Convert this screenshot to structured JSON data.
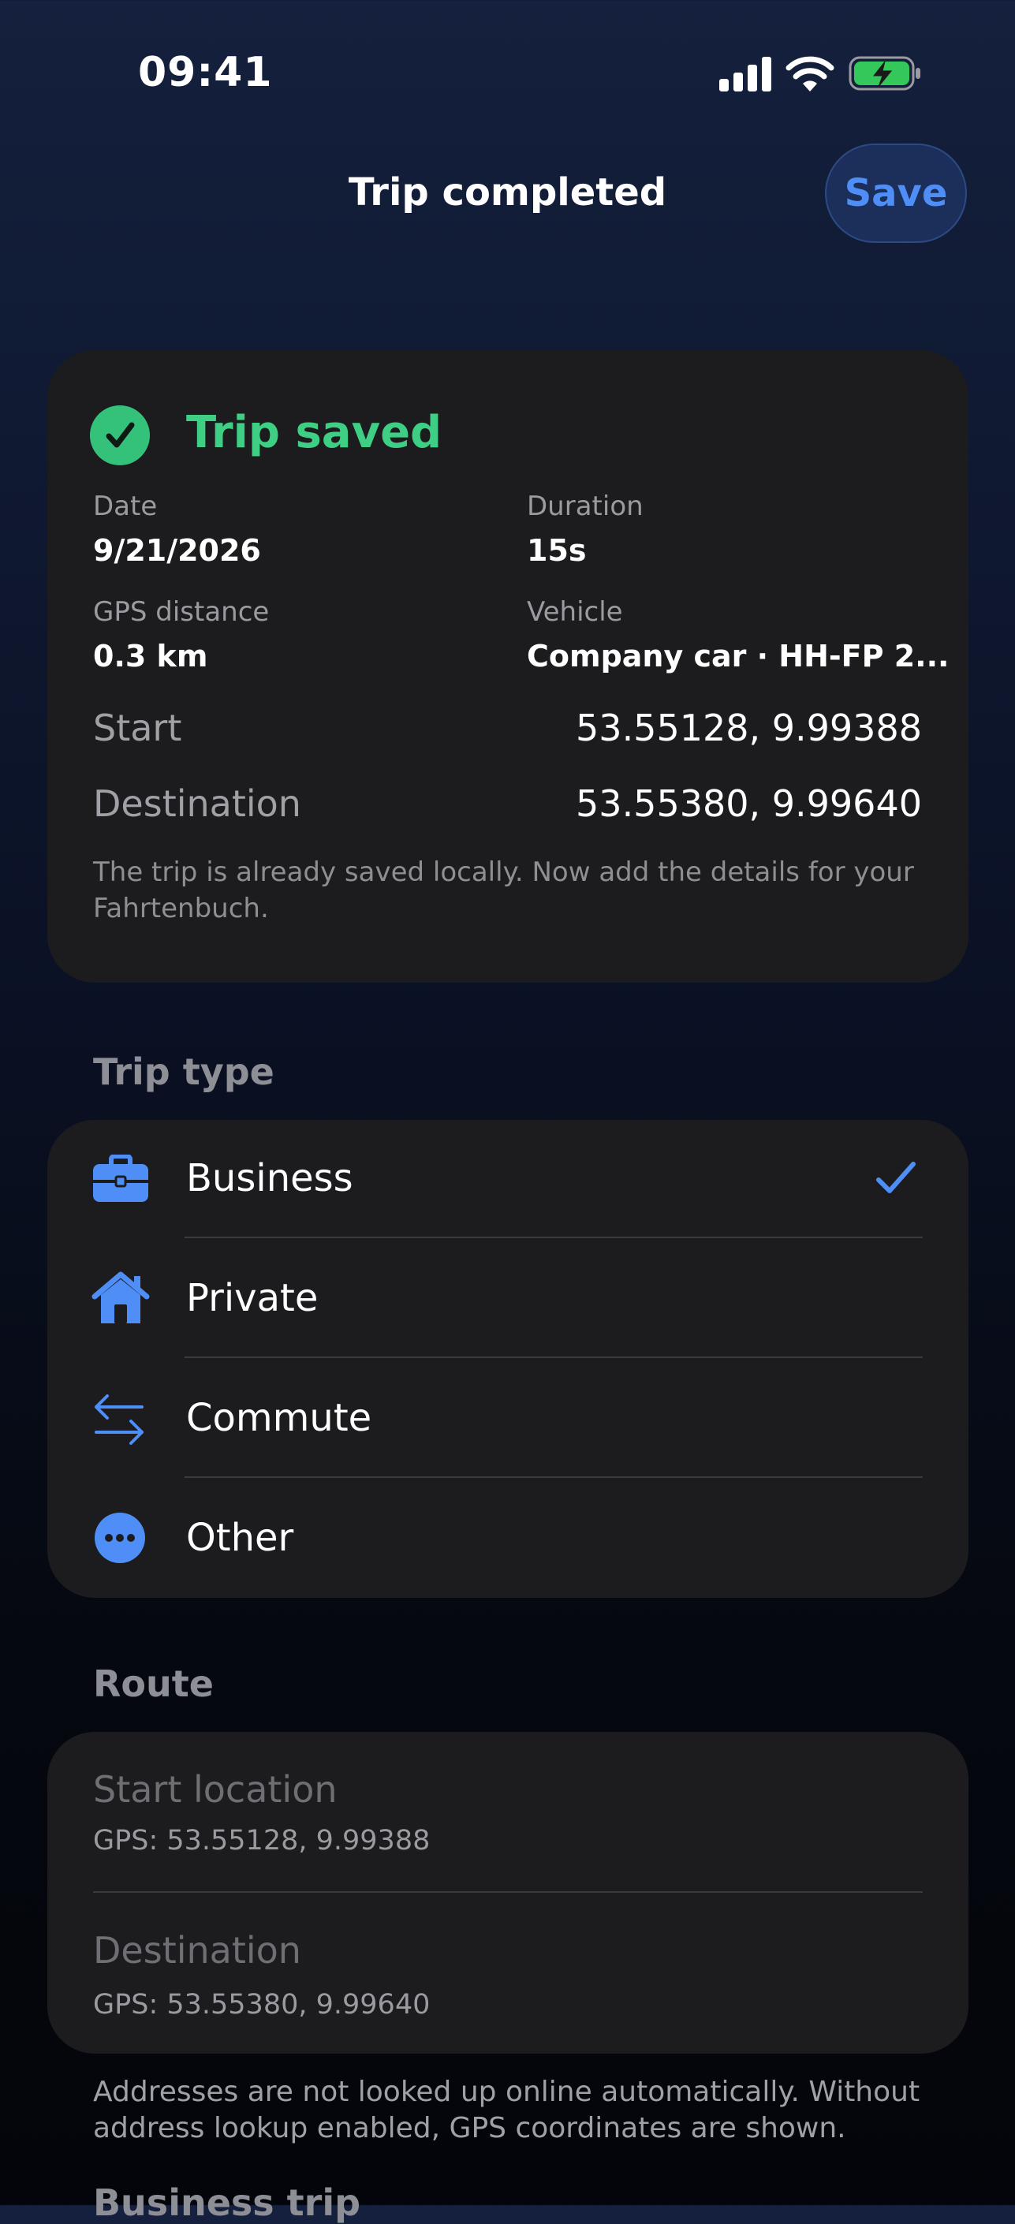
{
  "status_bar": {
    "time": "09:41"
  },
  "header": {
    "title": "Trip completed",
    "save_label": "Save"
  },
  "summary": {
    "title": "Trip saved",
    "date_label": "Date",
    "date_value": "9/21/2026",
    "duration_label": "Duration",
    "duration_value": "15s",
    "distance_label": "GPS distance",
    "distance_value": "0.3 km",
    "vehicle_label": "Vehicle",
    "vehicle_value": "Company car · HH-FP 2...",
    "start_label": "Start",
    "start_value": "53.55128, 9.99388",
    "destination_label": "Destination",
    "destination_value": "53.55380, 9.99640",
    "note_line1": "The trip is already saved locally. Now add the details for your",
    "note_line2": "Fahrtenbuch."
  },
  "trip_type": {
    "heading": "Trip type",
    "options": [
      {
        "label": "Business",
        "icon": "briefcase-icon",
        "selected": true
      },
      {
        "label": "Private",
        "icon": "house-icon",
        "selected": false
      },
      {
        "label": "Commute",
        "icon": "arrows-swap-icon",
        "selected": false
      },
      {
        "label": "Other",
        "icon": "ellipsis-circle-icon",
        "selected": false
      }
    ]
  },
  "route": {
    "heading": "Route",
    "start_placeholder": "Start location",
    "start_gps": "GPS: 53.55128, 9.99388",
    "destination_placeholder": "Destination",
    "destination_gps": "GPS: 53.55380, 9.99640",
    "footnote_line1": "Addresses are not looked up online automatically. Without",
    "footnote_line2": "address lookup enabled, GPS coordinates are shown."
  },
  "next_section": {
    "heading": "Business trip"
  },
  "colors": {
    "accent_blue": "#4f8ef7",
    "success_green": "#3ecf84",
    "card_bg": "#1c1c1e"
  }
}
